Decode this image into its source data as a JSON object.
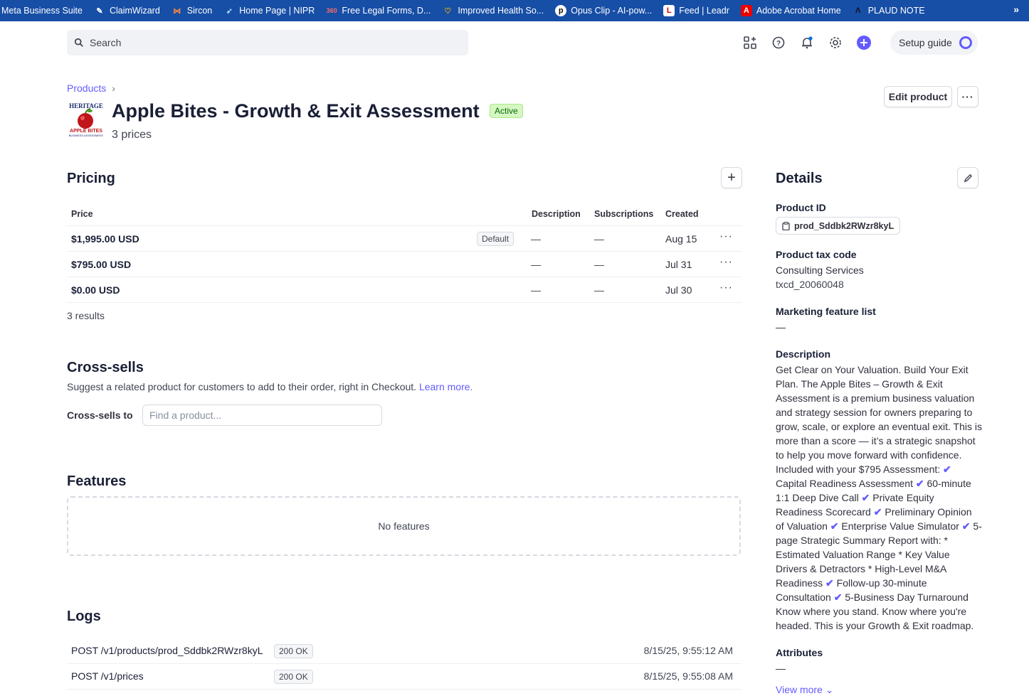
{
  "bookmarks": [
    {
      "label": "Meta Business Suite",
      "icon": "meta-icon"
    },
    {
      "label": "ClaimWizard",
      "icon": "claimwizard-icon"
    },
    {
      "label": "Sircon",
      "icon": "sircon-icon"
    },
    {
      "label": "Home Page | NIPR",
      "icon": "nipr-icon"
    },
    {
      "label": "Free Legal Forms, D...",
      "icon": "legal-forms-icon"
    },
    {
      "label": "Improved Health So...",
      "icon": "heart-icon"
    },
    {
      "label": "Opus Clip - AI-pow...",
      "icon": "opus-clip-icon"
    },
    {
      "label": "Feed | Leadr",
      "icon": "leadr-icon"
    },
    {
      "label": "Adobe Acrobat Home",
      "icon": "acrobat-icon"
    },
    {
      "label": "PLAUD NOTE",
      "icon": "plaud-icon"
    }
  ],
  "search": {
    "placeholder": "Search"
  },
  "setup_guide": "Setup guide",
  "breadcrumb": {
    "products": "Products"
  },
  "product": {
    "title": "Apple Bites - Growth & Exit Assessment",
    "status": "Active",
    "subtitle": "3 prices",
    "logo_text": "HERITAGE / APPLE BITES / BUSINESS ASSESSMENT"
  },
  "actions": {
    "edit": "Edit product",
    "more": "···"
  },
  "pricing": {
    "heading": "Pricing",
    "headers": {
      "price": "Price",
      "description": "Description",
      "subscriptions": "Subscriptions",
      "created": "Created"
    },
    "rows": [
      {
        "price": "$1,995.00 USD",
        "badge": "Default",
        "description": "—",
        "subscriptions": "—",
        "created": "Aug 15"
      },
      {
        "price": "$795.00 USD",
        "badge": "",
        "description": "—",
        "subscriptions": "—",
        "created": "Jul 31"
      },
      {
        "price": "$0.00 USD",
        "badge": "",
        "description": "—",
        "subscriptions": "—",
        "created": "Jul 30"
      }
    ],
    "results": "3 results"
  },
  "cross_sells": {
    "heading": "Cross-sells",
    "text": "Suggest a related product for customers to add to their order, right in Checkout.",
    "learn_more": "Learn more.",
    "label": "Cross-sells to",
    "placeholder": "Find a product..."
  },
  "features": {
    "heading": "Features",
    "empty": "No features"
  },
  "logs": {
    "heading": "Logs",
    "rows": [
      {
        "path": "POST /v1/products/prod_Sddbk2RWzr8kyL",
        "status": "200 OK",
        "time": "8/15/25, 9:55:12 AM"
      },
      {
        "path": "POST /v1/prices",
        "status": "200 OK",
        "time": "8/15/25, 9:55:08 AM"
      }
    ]
  },
  "details": {
    "heading": "Details",
    "product_id_label": "Product ID",
    "product_id": "prod_Sddbk2RWzr8kyL",
    "tax_code_label": "Product tax code",
    "tax_code_name": "Consulting Services",
    "tax_code": "txcd_20060048",
    "marketing_label": "Marketing feature list",
    "marketing_value": "—",
    "description_label": "Description",
    "description_parts": [
      "Get Clear on Your Valuation. Build Your Exit Plan. The Apple Bites – Growth & Exit Assessment is a premium business valuation and strategy session for owners preparing to grow, scale, or explore an eventual exit. This is more than a score — it’s a strategic snapshot to help you move forward with confidence. Included with your $795 Assessment: ",
      " Capital Readiness Assessment ",
      " 60-minute 1:1 Deep Dive Call ",
      " Private Equity Readiness Scorecard ",
      " Preliminary Opinion of Valuation ",
      " Enterprise Value Simulator ",
      " 5-page Strategic Summary Report with: * Estimated Valuation Range    * Key Value Drivers & Detractors    * High-Level M&A Readiness ",
      " Follow-up 30-minute Consultation ",
      " 5-Business Day Turnaround Know where you stand. Know where you're headed. This is your Growth & Exit roadmap."
    ],
    "attributes_label": "Attributes",
    "attributes_value": "—",
    "view_more": "View more"
  },
  "colors": {
    "accent": "#635bff",
    "bookmark_bar": "#174ea6",
    "active_badge": "#d7f7c2"
  }
}
